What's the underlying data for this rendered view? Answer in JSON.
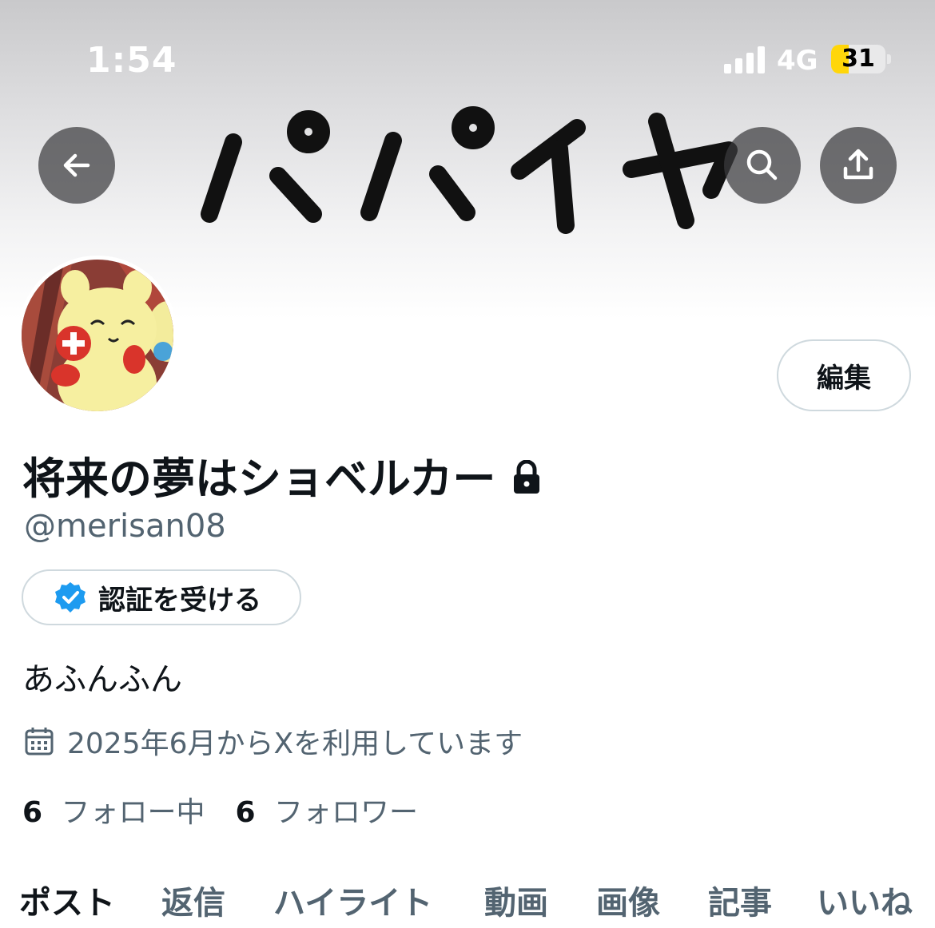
{
  "status_bar": {
    "time": "1:54",
    "network": "4G",
    "battery": "31"
  },
  "header": {
    "banner_text": "パパイヤ",
    "back_icon": "arrow-left-icon",
    "search_icon": "search-icon",
    "share_icon": "share-upload-icon"
  },
  "profile": {
    "edit_label": "編集",
    "name": "将来の夢はショベルカー",
    "handle": "@merisan08",
    "verify_label": "認証を受ける",
    "bio": "あふんふん",
    "joined": "2025年6月からXを利用しています",
    "following_count": "6",
    "following_label": "フォロー中",
    "followers_count": "6",
    "followers_label": "フォロワー"
  },
  "tabs": [
    "ポスト",
    "返信",
    "ハイライト",
    "動画",
    "画像",
    "記事",
    "いいね"
  ],
  "colors": {
    "verified_badge": "#1d9bf0",
    "battery_low": "#ffd60a",
    "secondary_text": "#536471"
  }
}
